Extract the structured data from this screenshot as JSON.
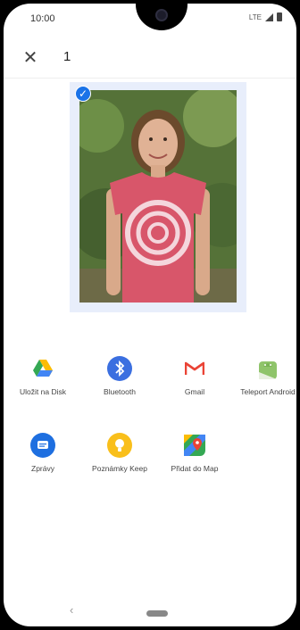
{
  "status": {
    "time": "10:00",
    "network": "LTE"
  },
  "header": {
    "close_label": "✕",
    "selected_count": "1"
  },
  "apps": [
    {
      "label": "Uložit na Disk",
      "icon": "google-drive-icon"
    },
    {
      "label": "Bluetooth",
      "icon": "bluetooth-icon"
    },
    {
      "label": "Gmail",
      "icon": "gmail-icon"
    },
    {
      "label": "Teleport Android",
      "icon": "teleport-android-icon"
    },
    {
      "label": "Zprávy",
      "icon": "messages-icon"
    },
    {
      "label": "Poznámky Keep",
      "icon": "keep-notes-icon"
    },
    {
      "label": "Přidat do Map",
      "icon": "maps-icon"
    }
  ],
  "nav": {
    "back_label": "‹"
  }
}
